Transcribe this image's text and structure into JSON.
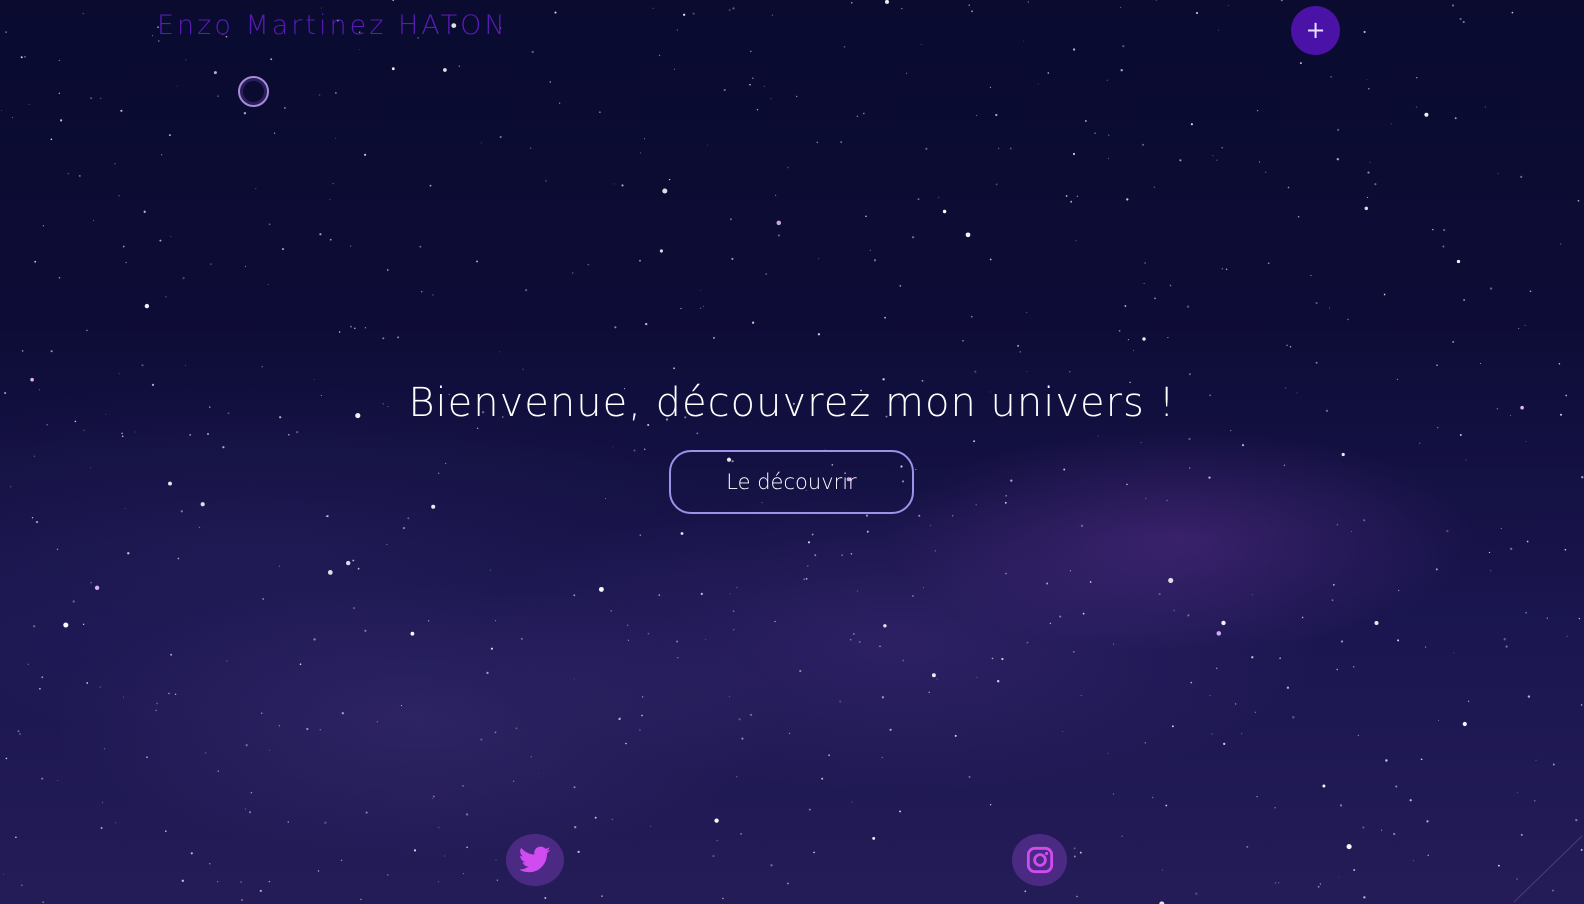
{
  "header": {
    "site_title": "Enzo Martinez HATON",
    "menu_toggle_label": "+"
  },
  "hero": {
    "heading": "Bienvenue,  découvrez mon univers  !",
    "cta_label": "Le découvrir"
  },
  "social": {
    "twitter_icon": "twitter-bird-icon",
    "instagram_icon": "instagram-icon"
  },
  "colors": {
    "brand_purple": "#5a1bb8",
    "accent_button": "#4b12a8",
    "cta_border": "#9b94e6",
    "social_icon": "#d14cf0"
  }
}
